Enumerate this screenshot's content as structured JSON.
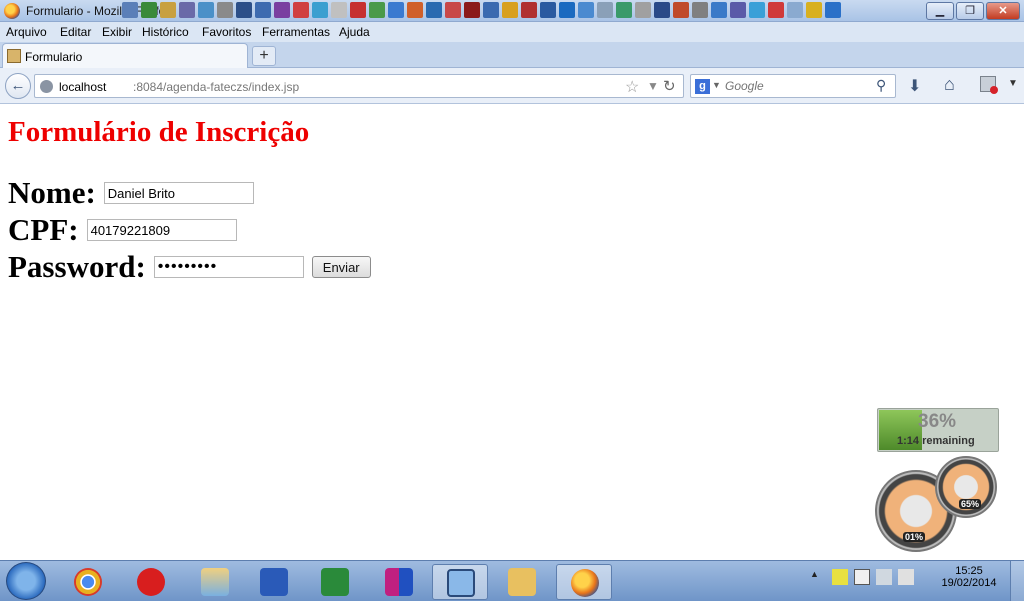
{
  "window": {
    "title": "Formulario - Mozilla Firefox",
    "controls": {
      "minimize": "▁",
      "maximize": "❐",
      "close": "✕"
    }
  },
  "menu": {
    "items": [
      "Arquivo",
      "Editar",
      "Exibir",
      "Histórico",
      "Favoritos",
      "Ferramentas",
      "Ajuda"
    ]
  },
  "tabs": [
    {
      "label": "Formulario",
      "active": true
    }
  ],
  "new_tab_label": "+",
  "nav": {
    "url_host": "localhost",
    "url_path": ":8084/agenda-fateczs/index.jsp",
    "search_engine_icon": "g",
    "search_placeholder": "Google"
  },
  "form": {
    "title": "Formulário de Inscrição",
    "nome_label": "Nome:",
    "nome_value": "Daniel Brito",
    "cpf_label": "CPF:",
    "cpf_value": "40179221809",
    "password_label": "Password:",
    "password_value": "•••••••••",
    "submit_label": "Enviar"
  },
  "gadgets": {
    "battery": {
      "percent": "36%",
      "percent_value": 36,
      "time": "1:14",
      "remaining_label": "remaining"
    },
    "meters": {
      "cpu": "01%",
      "memory": "65%"
    }
  },
  "taskbar": {
    "apps": [
      "start",
      "chrome",
      "claro",
      "photo-viewer",
      "word",
      "excel",
      "winrar",
      "virtualbox",
      "explorer",
      "firefox"
    ],
    "clock_time": "15:25",
    "clock_date": "19/02/2014"
  },
  "colors": {
    "title_red": "#ee0000",
    "titlebar": "#b8cfee",
    "taskbar": "#85a8d6"
  }
}
